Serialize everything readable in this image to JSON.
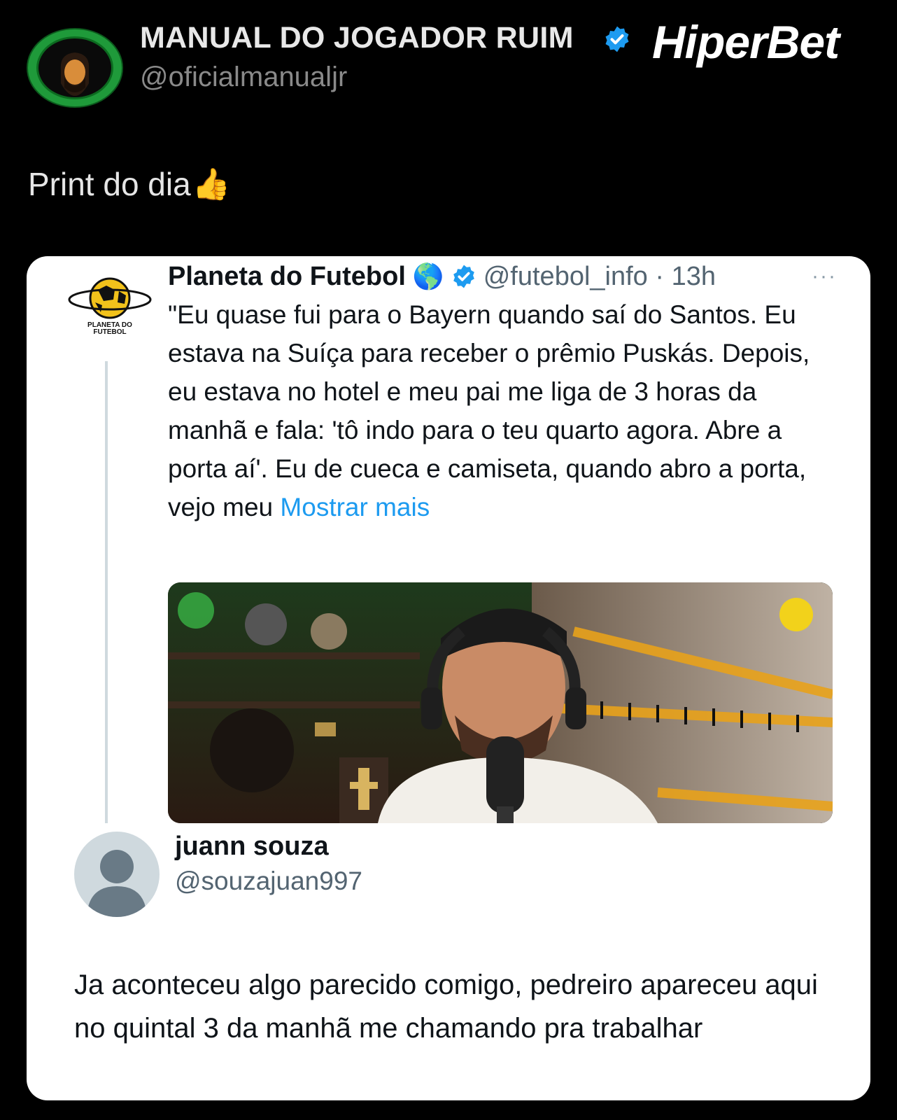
{
  "post": {
    "author_name": "MANUAL DO JOGADOR RUIM",
    "author_handle": "@oficialmanualjr",
    "brand_logo": "HiperBet",
    "caption": "Print do dia",
    "caption_emoji": "👍"
  },
  "quoted_tweet": {
    "name": "Planeta do Futebol",
    "name_emoji": "🌎",
    "handle_time": "@futebol_info · 13h",
    "more": "···",
    "logo_text": "PLANETA DO FUTEBOL",
    "text": "\"Eu quase fui para o Bayern quando saí do Santos. Eu estava na Suíça para receber o prêmio Puskás. Depois, eu estava no hotel e meu pai me liga de 3 horas da manhã e fala: 'tô indo para o teu quarto agora. Abre a porta aí'. Eu de cueca e camiseta, quando abro a porta, vejo meu ",
    "show_more": "Mostrar mais"
  },
  "reply": {
    "name": "juann souza",
    "handle": "@souzajuan997",
    "text": "Ja aconteceu algo parecido comigo, pedreiro apareceu aqui no quintal 3 da manhã me chamando pra trabalhar"
  },
  "colors": {
    "background": "#000000",
    "card": "#ffffff",
    "link": "#1d9bf0",
    "verified": "#1d9bf0",
    "avatar_ring": "#1f9a3a"
  }
}
